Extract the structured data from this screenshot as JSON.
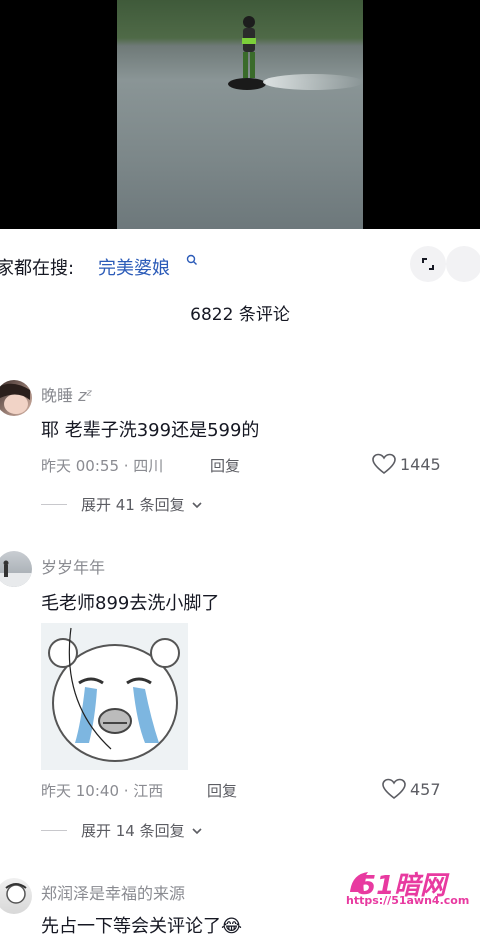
{
  "search": {
    "prefix": "家都在搜:",
    "term": "完美婆娘"
  },
  "comments_count": "6822 条评论",
  "comments": [
    {
      "username": "晚睡",
      "username_suffix": "zᶻ",
      "text": "耶 老辈子洗399还是599的",
      "time_location": "昨天 00:55 · 四川",
      "reply_label": "回复",
      "likes": "1445",
      "expand_label": "展开 41 条回复"
    },
    {
      "username": "岁岁年年",
      "text": "毛老师899去洗小脚了",
      "time_location": "昨天 10:40 · 江西",
      "reply_label": "回复",
      "likes": "457",
      "expand_label": "展开 14 条回复"
    },
    {
      "username": "郑润泽是幸福的来源",
      "text": "先占一下等会关评论了😂"
    }
  ],
  "watermark": {
    "logo_text": "51暗网",
    "url": "https://51awn4.com"
  },
  "colors": {
    "link_blue": "#2b5bb8",
    "muted_gray": "#8a8b91",
    "text_dark": "#161823",
    "watermark_pink": "#e83aa0"
  }
}
